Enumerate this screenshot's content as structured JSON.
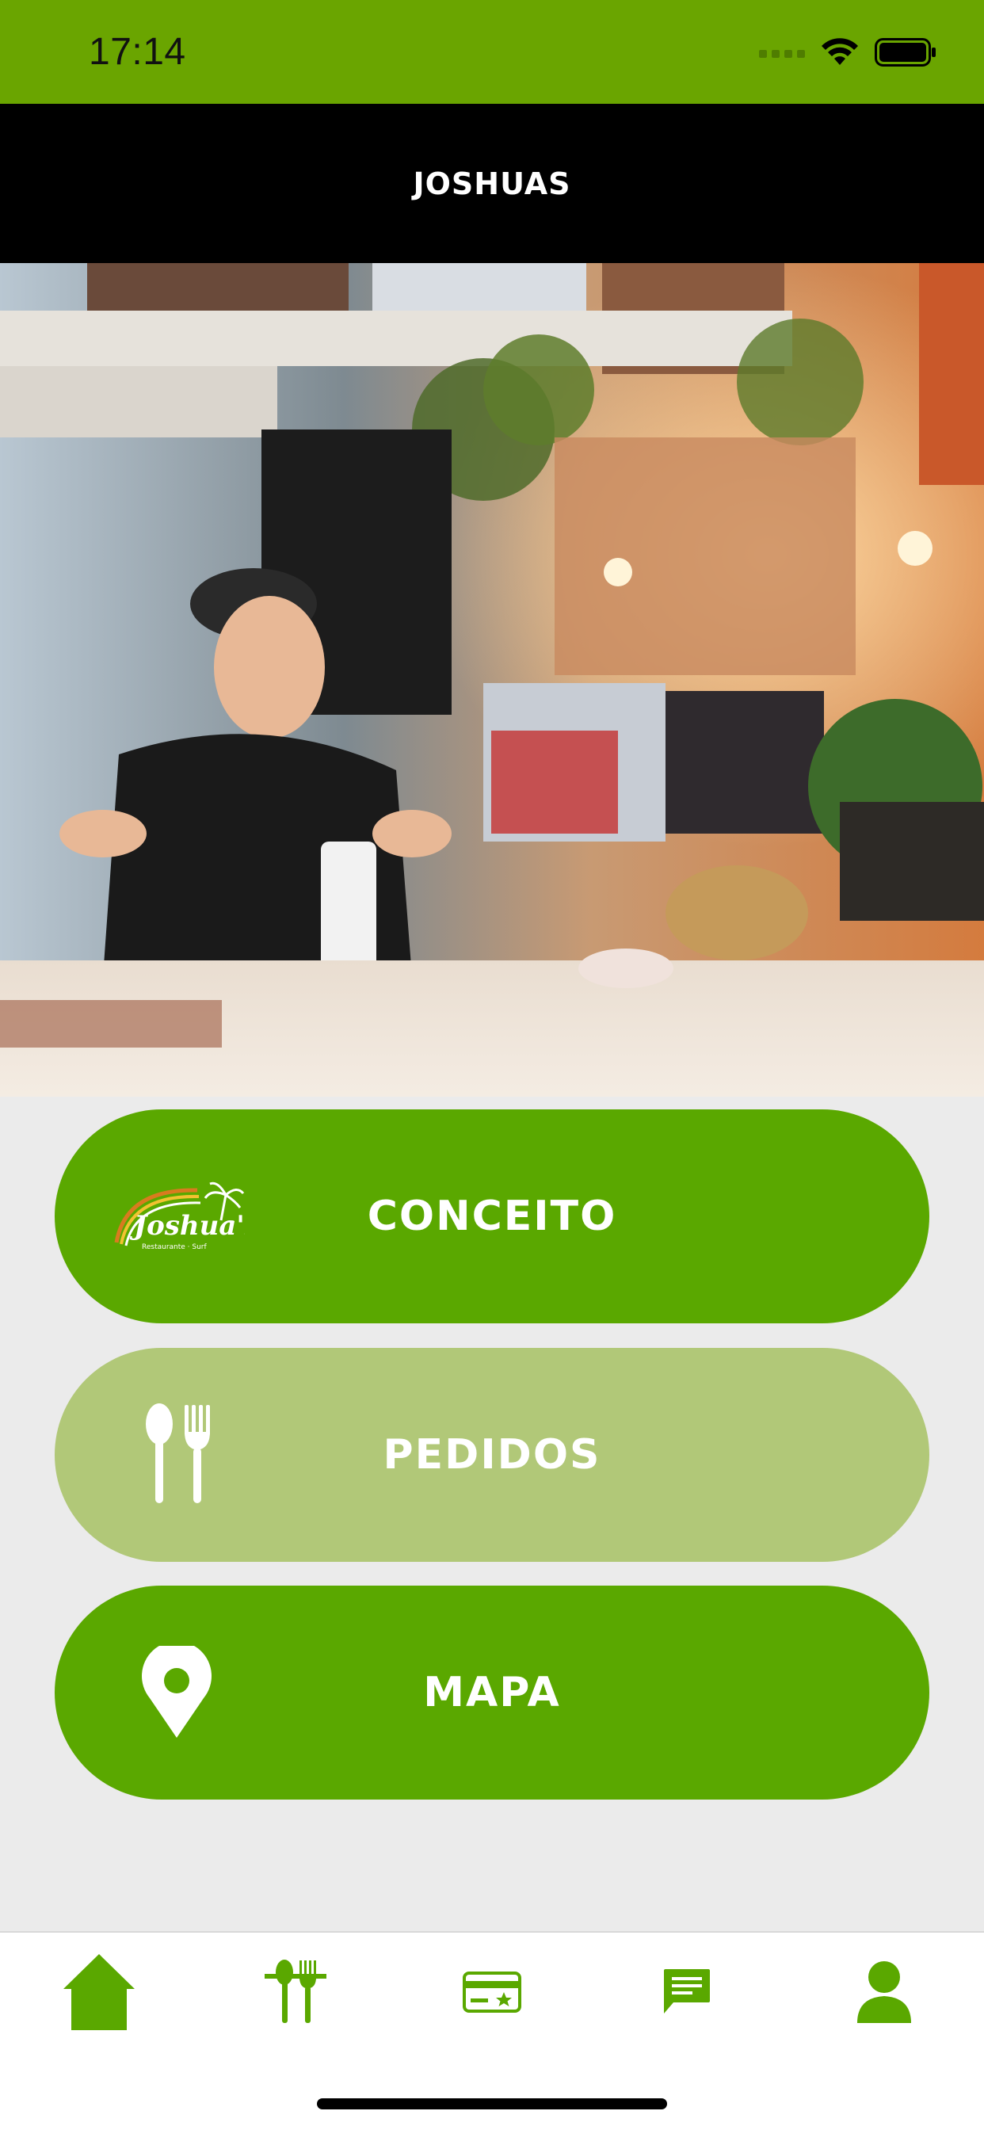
{
  "status_bar": {
    "time": "17:14",
    "background_color": "#6aa500"
  },
  "header": {
    "title": "JOSHUAS"
  },
  "hero": {
    "image": "restaurant-counter-photo"
  },
  "menu": {
    "buttons": [
      {
        "label": "CONCEITO",
        "icon": "joshuas-logo-icon",
        "color": "#5aa800"
      },
      {
        "label": "PEDIDOS",
        "icon": "spoon-fork-icon",
        "color": "#b1c878"
      },
      {
        "label": "MAPA",
        "icon": "map-pin-icon",
        "color": "#5aa800"
      }
    ]
  },
  "tab_bar": {
    "tabs": [
      {
        "name": "home",
        "icon": "home-icon"
      },
      {
        "name": "menu",
        "icon": "spoon-fork-icon",
        "active": true
      },
      {
        "name": "card",
        "icon": "loyalty-card-icon"
      },
      {
        "name": "chat",
        "icon": "chat-icon"
      },
      {
        "name": "profile",
        "icon": "user-icon"
      }
    ],
    "accent_color": "#5aa800"
  },
  "logo_text": "Joshua's"
}
